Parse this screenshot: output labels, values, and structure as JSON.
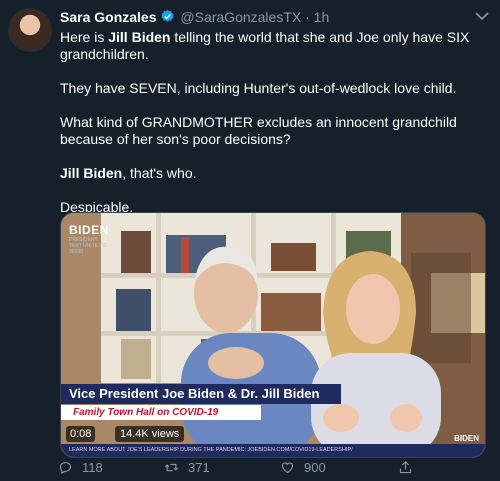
{
  "tweet": {
    "name": "Sara Gonzales",
    "handle": "@SaraGonzalesTX",
    "dot": "·",
    "time": "1h",
    "body": {
      "p1_pre": "Here is ",
      "p1_bold": "Jill Biden",
      "p1_post": " telling the world that she and Joe only have SIX grandchildren.",
      "p2": "They have SEVEN, including Hunter's out-of-wedlock love child.",
      "p3": "What kind of GRANDMOTHER excludes an innocent grandchild because of her son's poor decisions?",
      "p4_bold": "Jill Biden",
      "p4_post": ", that's who.",
      "p5": "Despicable."
    },
    "video": {
      "logo_text": "BIDEN",
      "logo_sub": "PRESIDENT",
      "logo_note": "TEXT UNITE TO 30330",
      "title": "Vice President Joe Biden & Dr. Jill Biden",
      "subtitle": "Family Town Hall on COVID-19",
      "timestamp": "0:08",
      "views": "14.4K views",
      "bottom_text": "LEARN MORE ABOUT JOE'S LEADERSHIP DURING THE PANDEMIC: JOEBIDEN.COM/COVID19-LEADERSHIP/",
      "corner_logo": "BIDEN"
    },
    "actions": {
      "reply_count": "118",
      "retweet_count": "371",
      "like_count": "900"
    }
  },
  "colors": {
    "background": "#15202b",
    "muted": "#8899a6",
    "verified": "#1da1f2",
    "banner_navy": "#1f2b5e",
    "banner_red": "#c8102e"
  },
  "icons": [
    "verified-badge-icon",
    "chevron-down-icon",
    "reply-icon",
    "retweet-icon",
    "like-icon",
    "share-icon"
  ]
}
